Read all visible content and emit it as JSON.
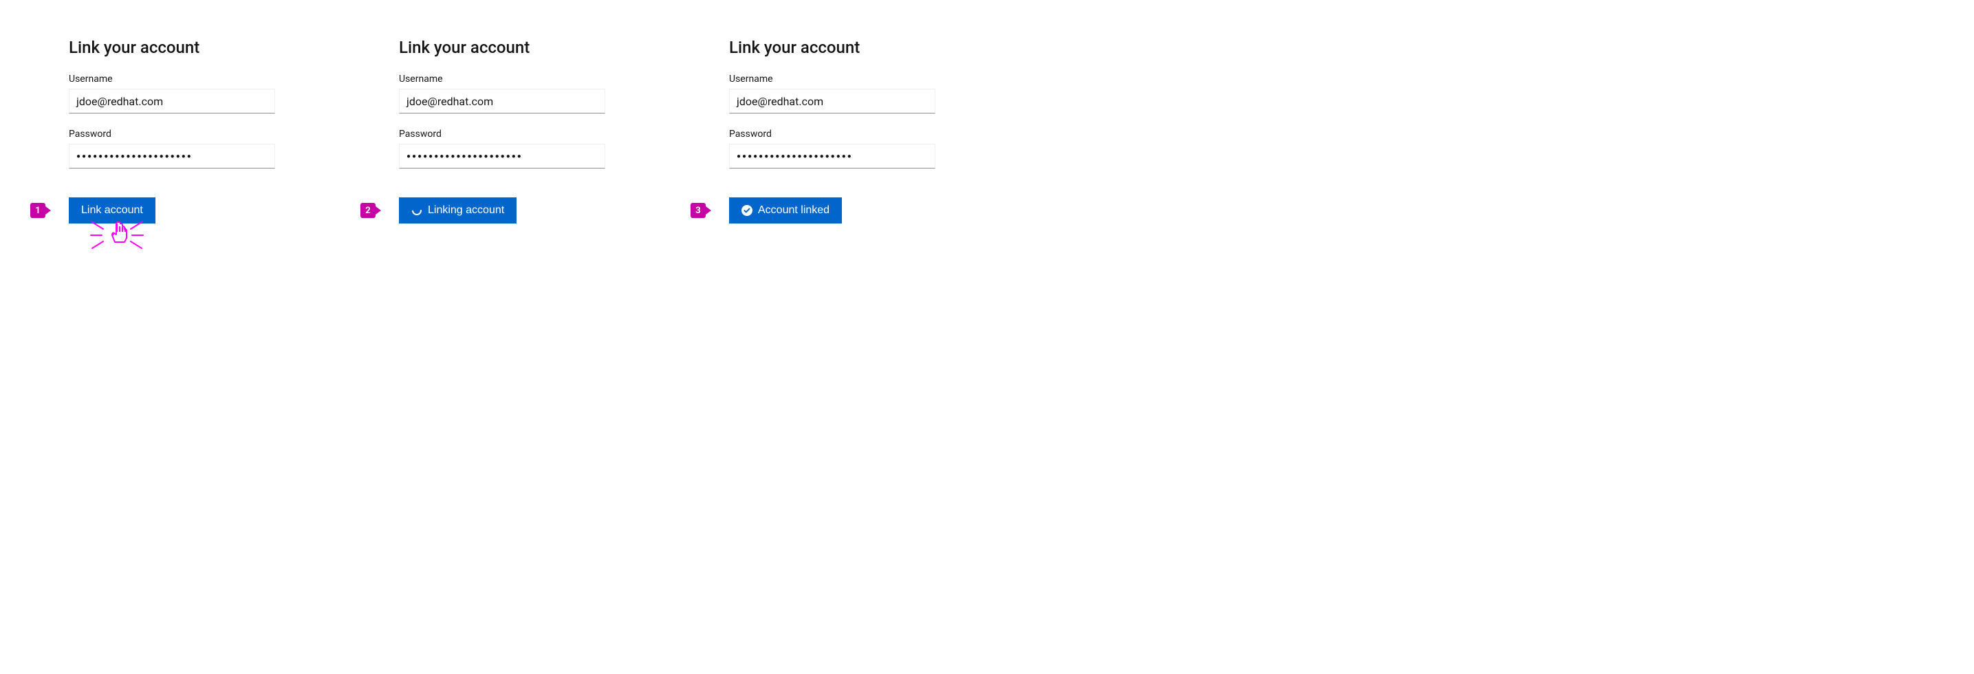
{
  "panels": [
    {
      "title": "Link your account",
      "usernameLabel": "Username",
      "usernameValue": "jdoe@redhat.com",
      "passwordLabel": "Password",
      "passwordValue": "●●●●●●●●●●●●●●●●●●●●●",
      "buttonLabel": "Link account",
      "stepNumber": "1",
      "state": "idle"
    },
    {
      "title": "Link your account",
      "usernameLabel": "Username",
      "usernameValue": "jdoe@redhat.com",
      "passwordLabel": "Password",
      "passwordValue": "●●●●●●●●●●●●●●●●●●●●●",
      "buttonLabel": "Linking account",
      "stepNumber": "2",
      "state": "loading"
    },
    {
      "title": "Link your account",
      "usernameLabel": "Username",
      "usernameValue": "jdoe@redhat.com",
      "passwordLabel": "Password",
      "passwordValue": "●●●●●●●●●●●●●●●●●●●●●",
      "buttonLabel": "Account linked",
      "stepNumber": "3",
      "state": "success"
    }
  ],
  "colors": {
    "primary": "#0066cc",
    "accent": "#c700a5",
    "magenta": "#ff00ff"
  }
}
